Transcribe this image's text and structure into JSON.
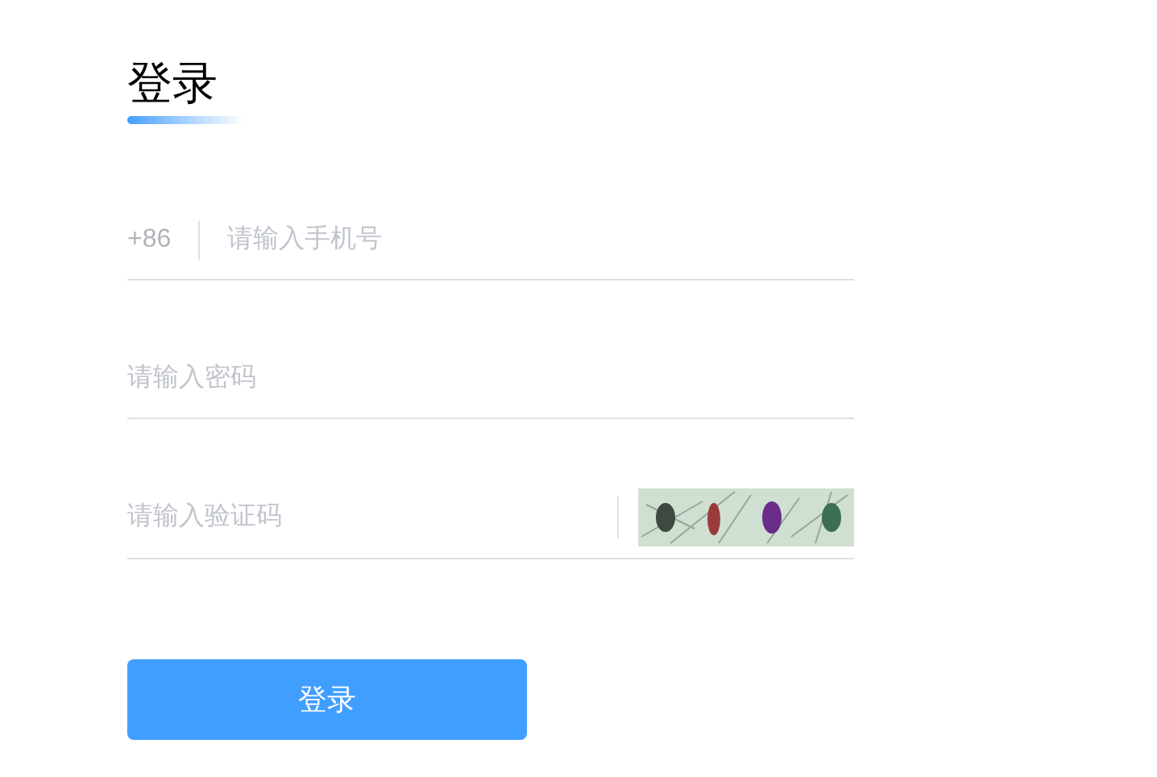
{
  "title": "登录",
  "phone": {
    "prefix": "+86",
    "placeholder": "请输入手机号"
  },
  "password": {
    "placeholder": "请输入密码"
  },
  "captcha": {
    "placeholder": "请输入验证码",
    "kind": "picture"
  },
  "submit": "登录"
}
